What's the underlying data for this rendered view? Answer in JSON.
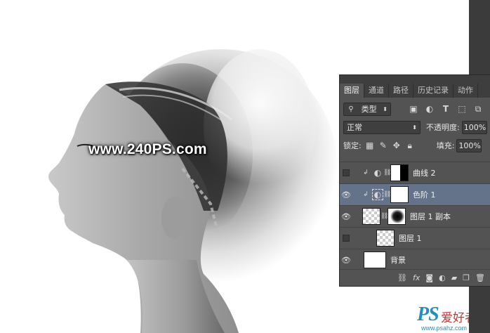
{
  "watermark": "www.240PS.com",
  "logo": {
    "ps": "PS",
    "cn": "爱好者",
    "url": "www.psahz.com"
  },
  "panel": {
    "tabs": [
      "图层",
      "通道",
      "路径",
      "历史记录",
      "动作"
    ],
    "active_tab": 0,
    "filter": {
      "label": "类型",
      "icons": [
        "image-filter-icon",
        "adjustment-filter-icon",
        "type-filter-icon",
        "shape-filter-icon",
        "smart-object-filter-icon"
      ]
    },
    "blend_mode": "正常",
    "opacity_label": "不透明度:",
    "opacity_value": "100%",
    "lock_label": "锁定:",
    "fill_label": "填充:",
    "fill_value": "100%",
    "layers": [
      {
        "name": "曲线 2",
        "visible": false,
        "type": "adjustment",
        "selected": false
      },
      {
        "name": "色阶 1",
        "visible": true,
        "type": "adjustment",
        "selected": true
      },
      {
        "name": "图层 1 副本",
        "visible": true,
        "type": "pixel-with-mask",
        "selected": false
      },
      {
        "name": "图层 1",
        "visible": false,
        "type": "pixel",
        "selected": false
      },
      {
        "name": "背景",
        "visible": true,
        "type": "background",
        "selected": false
      }
    ],
    "bottom_icons": [
      "link-layers-icon",
      "fx-icon",
      "add-mask-icon",
      "new-adjustment-icon",
      "new-group-icon",
      "new-layer-icon",
      "delete-layer-icon"
    ]
  }
}
